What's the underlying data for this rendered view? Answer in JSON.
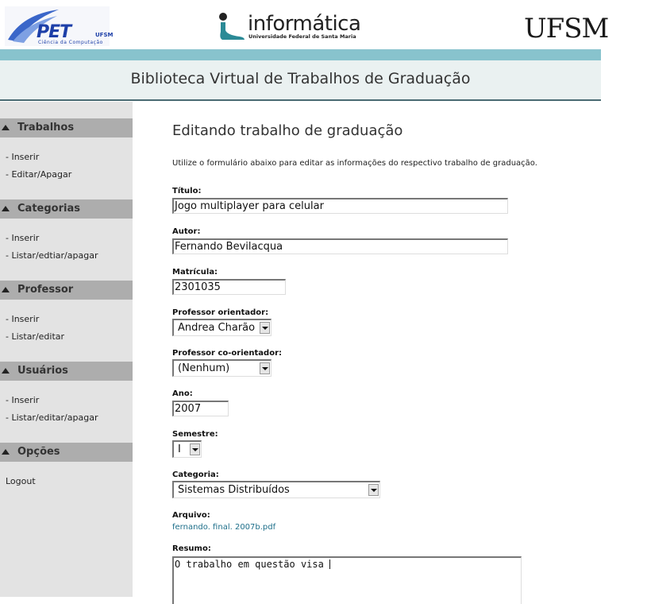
{
  "header": {
    "pet_logo": {
      "name": "PET",
      "ufsm": "UFSM",
      "subtitle": "Ciência da Computação"
    },
    "informatica_logo": {
      "word": "informática",
      "subtitle": "Universidade Federal de Santa Maria"
    },
    "ufsm_logo": "UFSM"
  },
  "titlebar": {
    "title": "Biblioteca Virtual de Trabalhos de Graduação"
  },
  "sidebar": {
    "sections": [
      {
        "title": "Trabalhos",
        "links": [
          "- Inserir",
          "- Editar/Apagar"
        ]
      },
      {
        "title": "Categorias",
        "links": [
          "- Inserir",
          "- Listar/edtiar/apagar"
        ]
      },
      {
        "title": "Professor",
        "links": [
          "- Inserir",
          "- Listar/editar"
        ]
      },
      {
        "title": "Usuários",
        "links": [
          "- Inserir",
          "- Listar/editar/apagar"
        ]
      },
      {
        "title": "Opções",
        "links": [
          "Logout"
        ]
      }
    ]
  },
  "main": {
    "heading": "Editando trabalho de graduação",
    "intro": "Utilize o formulário abaixo para editar as informações do respectivo trabalho de graduação.",
    "form": {
      "titulo": {
        "label": "Título:",
        "value": "Jogo multiplayer para celular"
      },
      "autor": {
        "label": "Autor:",
        "value": "Fernando Bevilacqua"
      },
      "matricula": {
        "label": "Matrícula:",
        "value": "2301035"
      },
      "orientador": {
        "label": "Professor orientador:",
        "value": "Andrea Charão"
      },
      "coorientador": {
        "label": "Professor co-orientador:",
        "value": "(Nenhum)"
      },
      "ano": {
        "label": "Ano:",
        "value": "2007"
      },
      "semestre": {
        "label": "Semestre:",
        "value": "I"
      },
      "categoria": {
        "label": "Categoria:",
        "value": "Sistemas Distribuídos"
      },
      "arquivo": {
        "label": "Arquivo:",
        "value": "fernando. final. 2007b.pdf"
      },
      "resumo": {
        "label": "Resumo:",
        "value": "O trabalho em questão visa "
      }
    }
  },
  "colors": {
    "stripe": "#88c3cd",
    "titlebar_bg": "#eaf1f1",
    "sidebar_bg": "#e3e3e3",
    "section_head": "#adadad",
    "link": "#1e6f8a"
  }
}
